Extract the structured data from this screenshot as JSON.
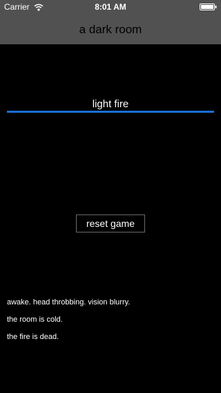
{
  "status_bar": {
    "carrier": "Carrier",
    "time": "8:01 AM",
    "wifi_icon": "wifi-icon",
    "battery_icon": "battery-full-icon"
  },
  "nav": {
    "title": "a dark room"
  },
  "actions": {
    "light_fire": "light fire",
    "reset_game": "reset game"
  },
  "log": [
    "awake. head throbbing. vision blurry.",
    "the room is cold.",
    "the fire is dead."
  ],
  "colors": {
    "background": "#000000",
    "bar_background": "#515151",
    "accent": "#1a6fd6",
    "text": "#ffffff"
  }
}
